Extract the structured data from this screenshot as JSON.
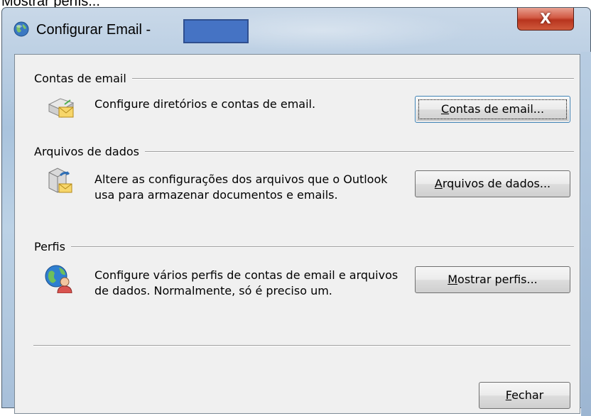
{
  "caption": "Mostrar perfis...",
  "window": {
    "title": "Configurar Email -",
    "close_label": "X"
  },
  "sections": {
    "contas": {
      "heading": "Contas de email",
      "description": "Configure diretórios e contas de email.",
      "button_mnemonic": "C",
      "button_rest": "ontas de email..."
    },
    "arquivos": {
      "heading": "Arquivos de dados",
      "description": "Altere as configurações dos arquivos que o Outlook usa para armazenar documentos e emails.",
      "button_mnemonic": "A",
      "button_rest": "rquivos de dados..."
    },
    "perfis": {
      "heading": "Perfis",
      "description": "Configure vários perfis de contas de email e arquivos de dados. Normalmente, só é preciso um.",
      "button_mnemonic": "M",
      "button_rest": "ostrar perfis..."
    }
  },
  "footer": {
    "close_mnemonic": "F",
    "close_rest": "echar"
  }
}
